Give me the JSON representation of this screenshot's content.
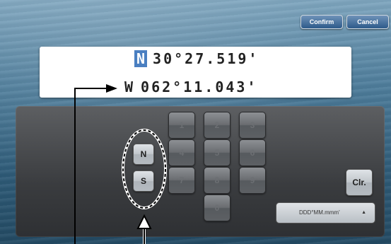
{
  "buttons": {
    "confirm": "Confirm",
    "cancel": "Cancel"
  },
  "display": {
    "lat_hemisphere": "N",
    "lat_value": "30°27.519'",
    "lon_hemisphere": "W",
    "lon_value": "062°11.043'"
  },
  "keypad": {
    "digits": [
      "1",
      "2",
      "3",
      "4",
      "5",
      "6",
      "7",
      "8",
      "9",
      "0"
    ],
    "hemi_n": "N",
    "hemi_s": "S",
    "clear": "Clr.",
    "format": "DDD°MM.mmm'"
  },
  "colors": {
    "accent": "#4a7fc1",
    "panel": "#3a3c3f",
    "sea": "#2e5f7e"
  }
}
